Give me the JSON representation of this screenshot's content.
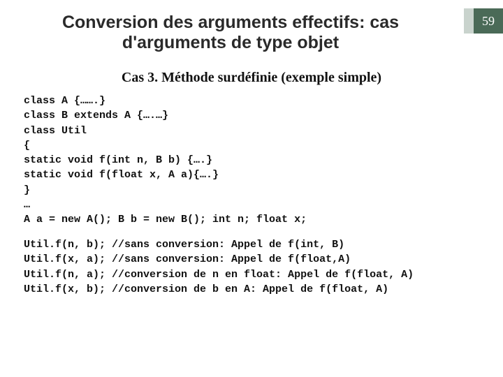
{
  "page": {
    "number": "59"
  },
  "title": {
    "line1": "Conversion des arguments effectifs: cas",
    "line2": "d'arguments de type objet"
  },
  "subtitle": "Cas 3. Méthode surdéfinie  (exemple simple)",
  "code": {
    "block1": "class A {…….}\nclass B extends A {….…}\nclass Util\n{\nstatic void f(int n, B b) {….}\nstatic void f(float x, A a){….}\n}\n…\nA a = new A(); B b = new B(); int n; float x;",
    "block2": "Util.f(n, b); //sans conversion: Appel de f(int, B)\nUtil.f(x, a); //sans conversion: Appel de f(float,A)\nUtil.f(n, a); //conversion de n en float: Appel de f(float, A)\nUtil.f(x, b); //conversion de b en A: Appel de f(float, A)"
  }
}
